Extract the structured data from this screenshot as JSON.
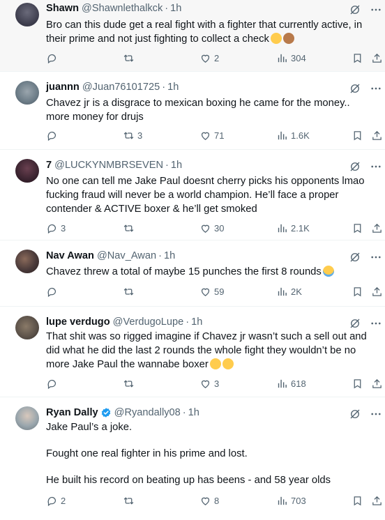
{
  "tweets": [
    {
      "name": "Shawn",
      "handle": "@Shawnlethalkck",
      "time": "1h",
      "verified": false,
      "lines": [
        "Bro can this dude get a real fight with a fighter that currently active, in their prime and not just fighting to collect a check"
      ],
      "emoji": [
        "thinking-face",
        "facepalm"
      ],
      "replies": "",
      "reposts": "",
      "likes": "2",
      "views": "304",
      "avatar_color": "#3a3a4a"
    },
    {
      "name": "juannn",
      "handle": "@Juan76101725",
      "time": "1h",
      "verified": false,
      "lines": [
        "Chavez jr is a disgrace to mexican boxing he came for the money.. more money for drujs"
      ],
      "emoji": [],
      "replies": "",
      "reposts": "3",
      "likes": "71",
      "views": "1.6K",
      "avatar_color": "#6b7b86"
    },
    {
      "name": "7",
      "handle": "@LUCKYNMBRSEVEN",
      "time": "1h",
      "verified": false,
      "lines": [
        "No one can tell me Jake Paul doesnt cherry picks his opponents lmao fucking fraud will never be a world champion. He’ll face a proper contender & ACTIVE boxer & he’ll get smoked"
      ],
      "emoji": [],
      "replies": "3",
      "reposts": "",
      "likes": "30",
      "views": "2.1K",
      "avatar_color": "#3b2430"
    },
    {
      "name": "Nav Awan",
      "handle": "@Nav_Awan",
      "time": "1h",
      "verified": false,
      "lines": [
        "Chavez threw a total of maybe 15 punches the first 8 rounds"
      ],
      "emoji": [
        "crying-face"
      ],
      "replies": "",
      "reposts": "",
      "likes": "59",
      "views": "2K",
      "avatar_color": "#4a3a3a"
    },
    {
      "name": "lupe verdugo",
      "handle": "@VerdugoLupe",
      "time": "1h",
      "verified": false,
      "lines": [
        "That shit was so rigged imagine if Chavez jr wasn’t such a sell out and did what he did the last 2 rounds the whole fight they wouldn’t be no more Jake Paul the wannabe boxer"
      ],
      "emoji": [
        "joy-face",
        "joy-face"
      ],
      "replies": "",
      "reposts": "",
      "likes": "3",
      "views": "618",
      "avatar_color": "#5a5048"
    },
    {
      "name": "Ryan Dally",
      "handle": "@Ryandally08",
      "time": "1h",
      "verified": true,
      "lines": [
        "Jake Paul’s a joke.",
        "Fought one real fighter in his prime and lost.",
        "He built his record on beating up has beens - and 58 year olds"
      ],
      "emoji": [],
      "replies": "2",
      "reposts": "",
      "likes": "8",
      "views": "703",
      "avatar_color": "#9aa6ad"
    }
  ],
  "colors": {
    "text": "#0f1419",
    "muted": "#536471",
    "border": "#eff3f4",
    "verified": "#1d9bf0",
    "emoji": "#ffcc4d"
  }
}
